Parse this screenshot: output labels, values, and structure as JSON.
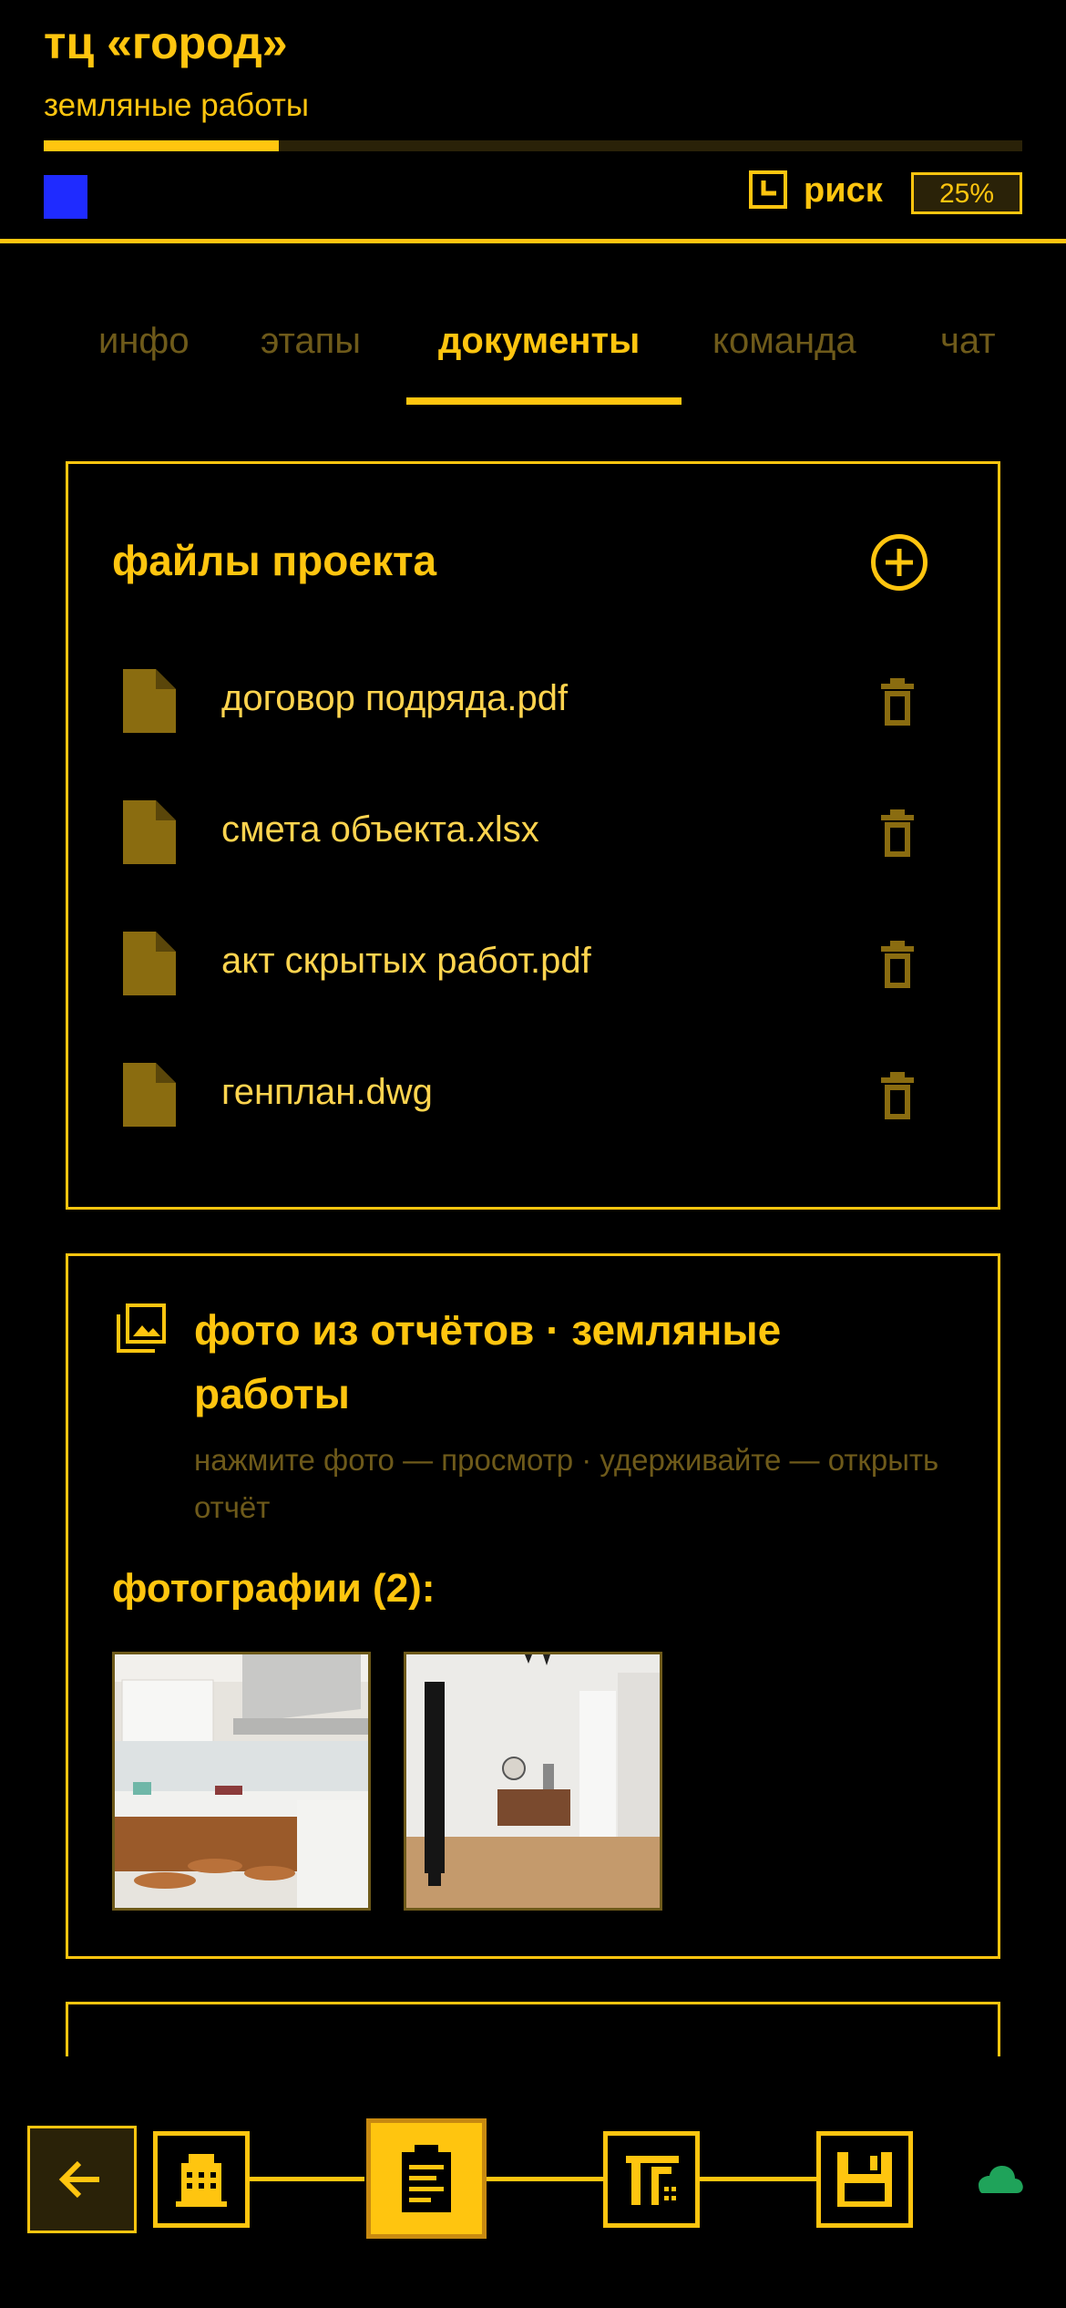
{
  "header": {
    "title": "тц «город»",
    "subtitle": "земляные работы",
    "progress": 0.24,
    "risk_label": "риск",
    "risk_value": "25%",
    "status_color": "#1F2BFF"
  },
  "tabs": [
    {
      "label": "инфо"
    },
    {
      "label": "этапы"
    },
    {
      "label": "документы",
      "active": true
    },
    {
      "label": "команда"
    },
    {
      "label": "чат"
    }
  ],
  "files": {
    "title": "файлы проекта",
    "items": [
      {
        "name": "договор подряда.pdf"
      },
      {
        "name": "смета объекта.xlsx"
      },
      {
        "name": "акт скрытых работ.pdf"
      },
      {
        "name": "генплан.dwg"
      }
    ]
  },
  "photos": {
    "title": "фото из отчётов · земляные работы",
    "hint": "нажмите фото — просмотр · удерживайте — открыть отчёт",
    "count_label": "фотографии (2):"
  },
  "icons": {
    "add": "add-circle-icon",
    "file": "file-icon",
    "delete": "trash-icon",
    "photos": "photo-library-icon",
    "back": "arrow-left-icon",
    "cloud": "cloud-icon"
  },
  "colors": {
    "accent": "#FFC50F",
    "muted": "#6E5A1A",
    "background": "#000000",
    "cloud": "#1FA35A"
  }
}
